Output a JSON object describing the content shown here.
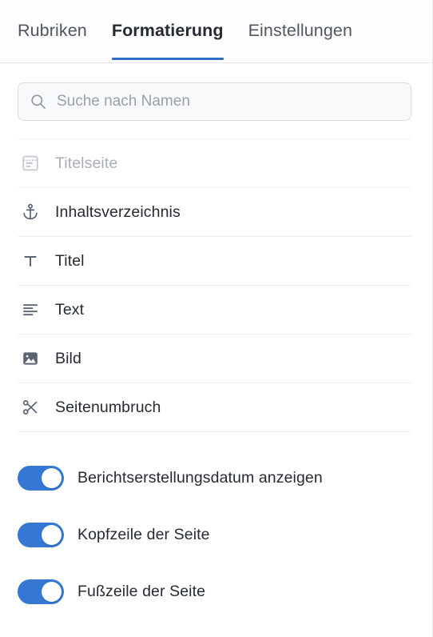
{
  "tabs": [
    {
      "label": "Rubriken",
      "active": false
    },
    {
      "label": "Formatierung",
      "active": true
    },
    {
      "label": "Einstellungen",
      "active": false
    }
  ],
  "search": {
    "placeholder": "Suche nach Namen",
    "value": "",
    "icon": "search-icon"
  },
  "blocks": [
    {
      "label": "Titelseite",
      "icon": "title-page-icon",
      "disabled": true
    },
    {
      "label": "Inhaltsverzeichnis",
      "icon": "anchor-icon",
      "disabled": false
    },
    {
      "label": "Titel",
      "icon": "text-format-t-icon",
      "disabled": false
    },
    {
      "label": "Text",
      "icon": "text-lines-icon",
      "disabled": false
    },
    {
      "label": "Bild",
      "icon": "image-icon",
      "disabled": false
    },
    {
      "label": "Seitenumbruch",
      "icon": "scissors-icon",
      "disabled": false
    }
  ],
  "toggles": [
    {
      "label": "Berichtserstellungsdatum anzeigen",
      "on": true
    },
    {
      "label": "Kopfzeile der Seite",
      "on": true
    },
    {
      "label": "Fußzeile der Seite",
      "on": true
    }
  ],
  "colors": {
    "accent": "#2f6fc7",
    "toggle_on": "#3578d4",
    "text": "#262b33",
    "text_muted": "#9aa0ab",
    "icon": "#5b6472",
    "divider": "#eceef2"
  }
}
